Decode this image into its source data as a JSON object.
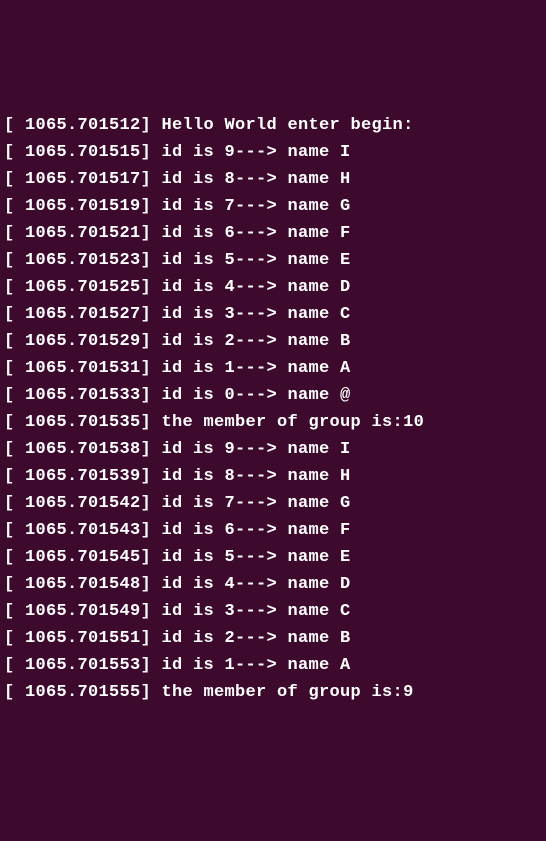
{
  "log": {
    "lines": [
      "[ 1065.701512] Hello World enter begin:",
      "[ 1065.701515] id is 9---> name I",
      "[ 1065.701517] id is 8---> name H",
      "[ 1065.701519] id is 7---> name G",
      "[ 1065.701521] id is 6---> name F",
      "[ 1065.701523] id is 5---> name E",
      "[ 1065.701525] id is 4---> name D",
      "[ 1065.701527] id is 3---> name C",
      "[ 1065.701529] id is 2---> name B",
      "[ 1065.701531] id is 1---> name A",
      "[ 1065.701533] id is 0---> name @",
      "[ 1065.701535] the member of group is:10",
      "[ 1065.701538] id is 9---> name I",
      "[ 1065.701539] id is 8---> name H",
      "[ 1065.701542] id is 7---> name G",
      "[ 1065.701543] id is 6---> name F",
      "[ 1065.701545] id is 5---> name E",
      "[ 1065.701548] id is 4---> name D",
      "[ 1065.701549] id is 3---> name C",
      "[ 1065.701551] id is 2---> name B",
      "[ 1065.701553] id is 1---> name A",
      "[ 1065.701555] the member of group is:9"
    ]
  }
}
